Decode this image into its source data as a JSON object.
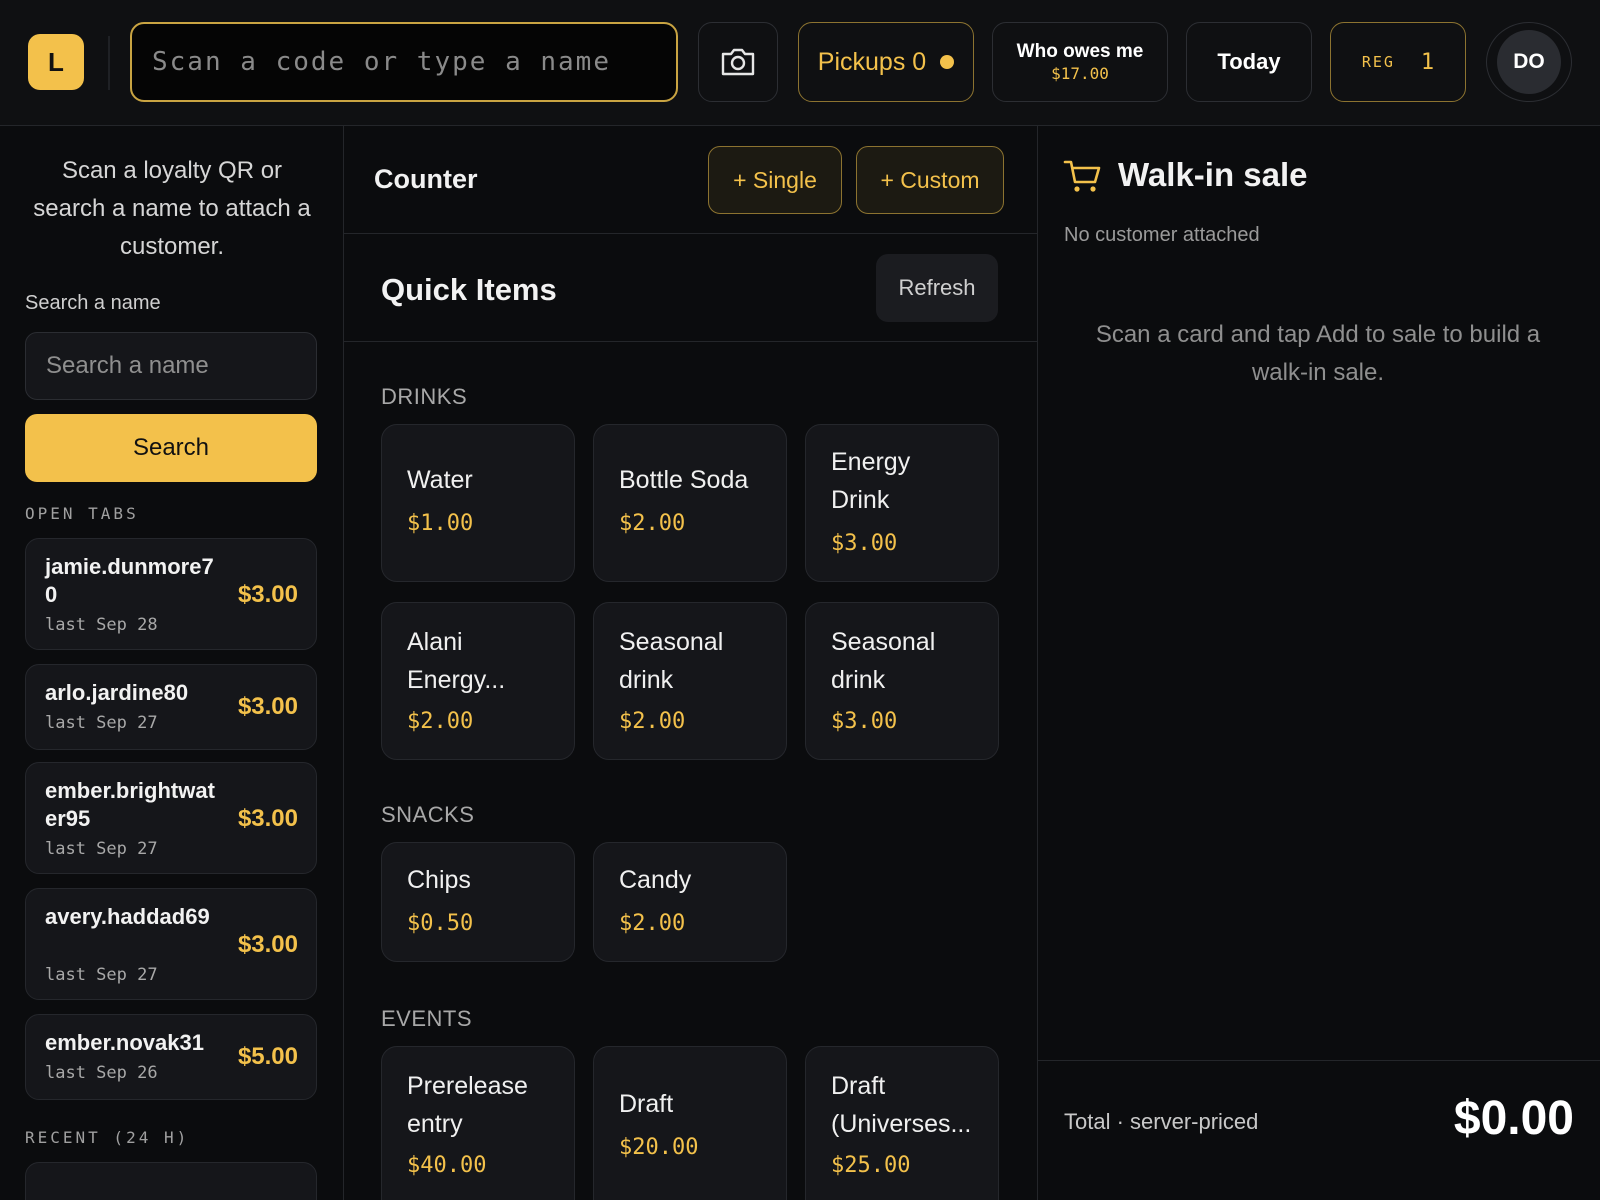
{
  "topbar": {
    "logo": "L",
    "scan_placeholder": "Scan a code or type a name",
    "camera_icon": "camera-icon",
    "pickups_label": "Pickups 0",
    "owes_label": "Who owes me",
    "owes_amount": "$17.00",
    "today_label": "Today",
    "reg_label": "REG",
    "reg_number": "1",
    "avatar_initials": "DO"
  },
  "left": {
    "hint": "Scan a loyalty QR or search a name to attach a customer.",
    "search_label": "Search a name",
    "search_placeholder": "Search a name",
    "search_button": "Search",
    "open_tabs_label": "OPEN TABS",
    "tabs": [
      {
        "name": "jamie.dunmore70",
        "amount": "$3.00",
        "last": "last Sep 28"
      },
      {
        "name": "arlo.jardine80",
        "amount": "$3.00",
        "last": "last Sep 27"
      },
      {
        "name": "ember.brightwater95",
        "amount": "$3.00",
        "last": "last Sep 27"
      },
      {
        "name": "avery.haddad69",
        "amount": "$3.00",
        "last": "last Sep 27"
      },
      {
        "name": "ember.novak31",
        "amount": "$5.00",
        "last": "last Sep 26"
      }
    ],
    "recent_label": "RECENT (24 H)"
  },
  "middle": {
    "counter_title": "Counter",
    "add_single": "+ Single",
    "add_custom": "+ Custom",
    "quick_title": "Quick Items",
    "refresh": "Refresh",
    "categories": [
      {
        "name": "DRINKS",
        "items": [
          {
            "name": "Water",
            "price": "$1.00"
          },
          {
            "name": "Bottle Soda",
            "price": "$2.00"
          },
          {
            "name": "Energy Drink",
            "price": "$3.00"
          },
          {
            "name": "Alani Energy...",
            "price": "$2.00"
          },
          {
            "name": "Seasonal drink",
            "price": "$2.00"
          },
          {
            "name": "Seasonal drink",
            "price": "$3.00"
          }
        ]
      },
      {
        "name": "SNACKS",
        "items": [
          {
            "name": "Chips",
            "price": "$0.50"
          },
          {
            "name": "Candy",
            "price": "$2.00"
          }
        ]
      },
      {
        "name": "EVENTS",
        "items": [
          {
            "name": "Prerelease entry",
            "price": "$40.00"
          },
          {
            "name": "Draft",
            "price": "$20.00"
          },
          {
            "name": "Draft (Universes...",
            "price": "$25.00"
          }
        ]
      }
    ]
  },
  "right": {
    "title": "Walk-in sale",
    "no_customer": "No customer attached",
    "empty_hint": "Scan a card and tap Add to sale to build a walk-in sale.",
    "total_label": "Total · server-priced",
    "total_value": "$0.00"
  },
  "colors": {
    "accent": "#f3c14b",
    "background": "#0b0c0e",
    "card": "#15161a"
  }
}
